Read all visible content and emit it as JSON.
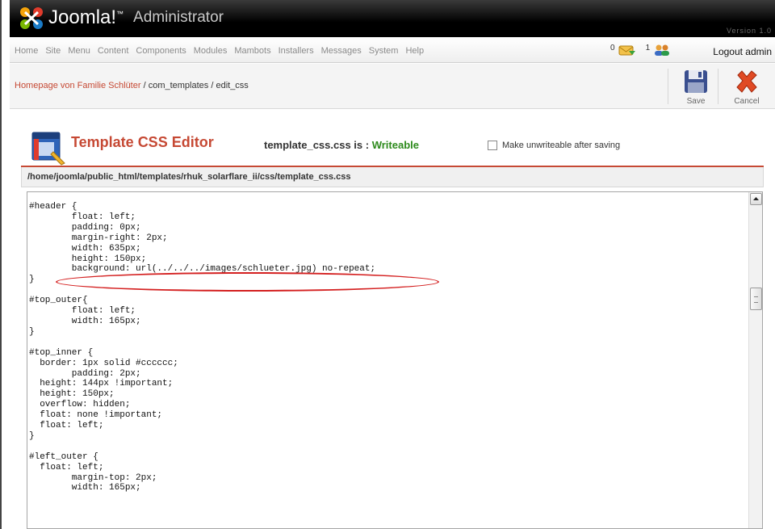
{
  "header": {
    "logo_text": "Joomla!",
    "logo_tm": "™",
    "subtitle": "Administrator",
    "version": "Version 1.0"
  },
  "menu": {
    "items": [
      "Home",
      "Site",
      "Menu",
      "Content",
      "Components",
      "Modules",
      "Mambots",
      "Installers",
      "Messages",
      "System",
      "Help"
    ]
  },
  "status": {
    "messages_count": "0",
    "messages_icon": "mail-icon",
    "users_count": "1",
    "users_icon": "users-icon",
    "logout_label": "Logout admin"
  },
  "breadcrumb": {
    "home": "Homepage von Familie Schlüter",
    "rest": " / com_templates / edit_css"
  },
  "toolbar": {
    "save_label": "Save",
    "cancel_label": "Cancel"
  },
  "editor_header": {
    "title": "Template CSS Editor",
    "file_status_prefix": "template_css.css is : ",
    "file_status_value": "Writeable",
    "unwriteable_label": "Make unwriteable after saving",
    "unwriteable_checked": false
  },
  "path": "/home/joomla/public_html/templates/rhuk_solarflare_ii/css/template_css.css",
  "code": "#header {\n        float: left;\n        padding: 0px;\n        margin-right: 2px;\n        width: 635px;\n        height: 150px;\n        background: url(../../../images/schlueter.jpg) no-repeat;\n}\n\n#top_outer{\n        float: left;\n        width: 165px;\n}\n\n#top_inner {\n  border: 1px solid #cccccc;\n        padding: 2px;\n  height: 144px !important;\n  height: 150px;\n  overflow: hidden;\n  float: none !important;\n  float: left;\n}\n\n#left_outer {\n  float: left;\n        margin-top: 2px;\n        width: 165px;",
  "colors": {
    "accent": "#c64934",
    "writeable": "#2d8a1c",
    "highlight": "#d42020"
  }
}
